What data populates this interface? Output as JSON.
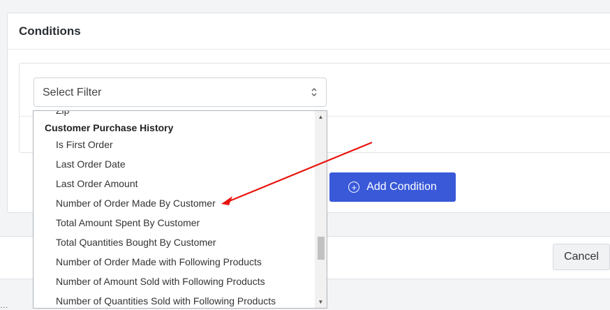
{
  "conditions": {
    "title": "Conditions",
    "select": {
      "value": "Select Filter"
    },
    "add_button_label": "Add Condition"
  },
  "dropdown": {
    "partial_item": "Zip",
    "group_label": "Customer Purchase History",
    "options": [
      "Is First Order",
      "Last Order Date",
      "Last Order Amount",
      "Number of Order Made By Customer",
      "Total Amount Spent By Customer",
      "Total Quantities Bought By Customer",
      "Number of Order Made with Following Products",
      "Number of Amount Sold with Following Products",
      "Number of Quantities Sold with Following Products"
    ],
    "scroll_position": 0.75
  },
  "footer": {
    "cancel_label": "Cancel",
    "partial_text": "…"
  },
  "colors": {
    "accent": "#3959d9",
    "annotation_arrow": "#e8140f"
  },
  "icons": {
    "select_chevrons": "chevron-up-down-icon",
    "add_condition": "plus-circle-icon"
  }
}
